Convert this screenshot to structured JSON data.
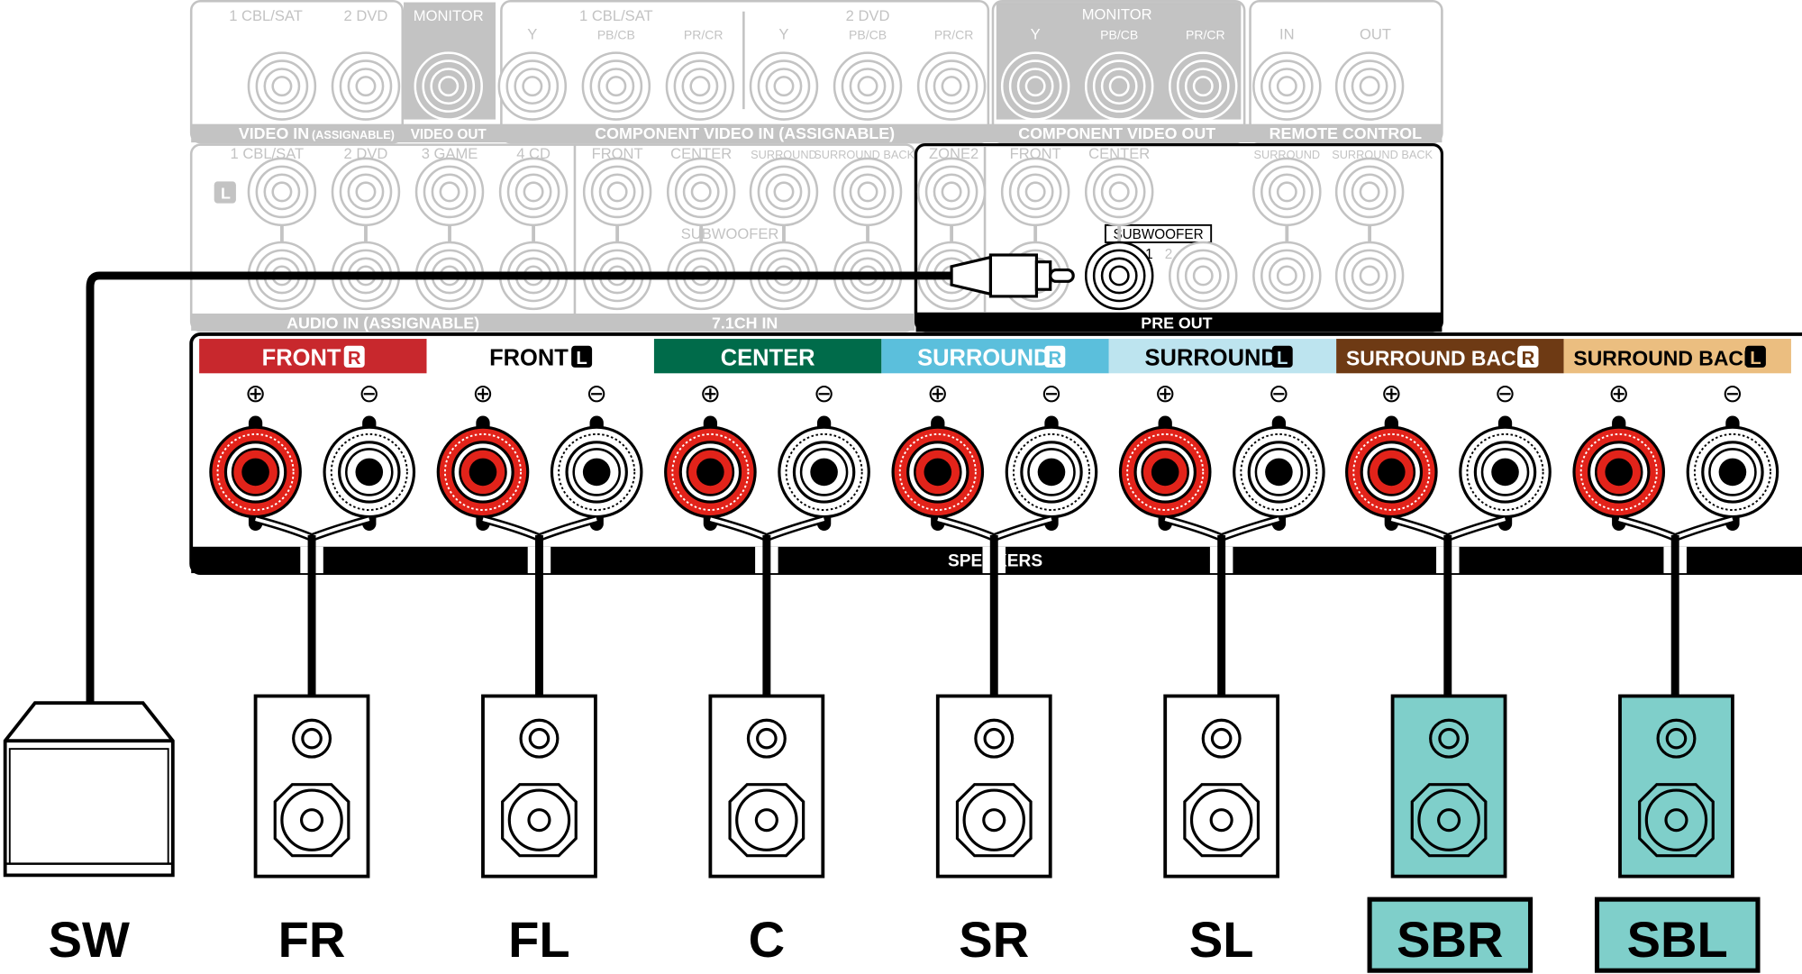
{
  "top_panel": {
    "video_in": {
      "inputs": [
        "1 CBL/SAT",
        "2 DVD"
      ],
      "title": "VIDEO IN",
      "title_suffix": "(ASSIGNABLE)"
    },
    "video_out": {
      "monitor": "MONITOR",
      "title": "VIDEO OUT"
    },
    "component_in": {
      "groups": [
        "1 CBL/SAT",
        "2 DVD"
      ],
      "channels": [
        "Y",
        "PB/CB",
        "PR/CR"
      ],
      "title": "COMPONENT VIDEO IN (ASSIGNABLE)"
    },
    "component_out": {
      "monitor": "MONITOR",
      "channels": [
        "Y",
        "PB/CB",
        "PR/CR"
      ],
      "title": "COMPONENT VIDEO OUT"
    },
    "remote": {
      "in": "IN",
      "out": "OUT",
      "title": "REMOTE CONTROL"
    },
    "audio_in": {
      "inputs": [
        "1 CBL/SAT",
        "2 DVD",
        "3 GAME",
        "4 CD"
      ],
      "l_badge": "L",
      "title": "AUDIO IN (ASSIGNABLE)"
    },
    "ch71_in": {
      "channels": [
        "FRONT",
        "CENTER",
        "SURROUND",
        "SURROUND BACK"
      ],
      "subwoofer": "SUBWOOFER",
      "title": "7.1CH IN"
    },
    "pre_out": {
      "zone2": "ZONE2",
      "front": "FRONT",
      "center": "CENTER",
      "surround": "SURROUND",
      "surround_back": "SURROUND BACK",
      "subwoofer": "SUBWOOFER",
      "sub1": "1",
      "sub2": "2",
      "title": "PRE OUT"
    }
  },
  "speakers_panel": {
    "title": "SPEAKERS",
    "plus": "⊕",
    "minus": "⊖",
    "channels": [
      {
        "label": "FRONT",
        "side": "R",
        "bg": "#c8282d",
        "fg": "#ffffff"
      },
      {
        "label": "FRONT",
        "side": "L",
        "bg": "#ffffff",
        "fg": "#000000"
      },
      {
        "label": "CENTER",
        "side": "",
        "bg": "#006b4a",
        "fg": "#ffffff"
      },
      {
        "label": "SURROUND",
        "side": "R",
        "bg": "#5bbfdc",
        "fg": "#ffffff"
      },
      {
        "label": "SURROUND",
        "side": "L",
        "bg": "#bde4ef",
        "fg": "#000000"
      },
      {
        "label": "SURROUND BACK",
        "side": "R",
        "bg": "#6e3a14",
        "fg": "#ffffff"
      },
      {
        "label": "SURROUND BACK",
        "side": "L",
        "bg": "#ebbe80",
        "fg": "#000000"
      }
    ]
  },
  "speakers": [
    {
      "label": "SW",
      "highlight": false
    },
    {
      "label": "FR",
      "highlight": false
    },
    {
      "label": "FL",
      "highlight": false
    },
    {
      "label": "C",
      "highlight": false
    },
    {
      "label": "SR",
      "highlight": false
    },
    {
      "label": "SL",
      "highlight": false
    },
    {
      "label": "SBR",
      "highlight": true
    },
    {
      "label": "SBL",
      "highlight": true
    }
  ],
  "colors": {
    "highlight": "#7fcfca",
    "terminal_red": "#e2231a",
    "faded": "#c3c3c3"
  }
}
